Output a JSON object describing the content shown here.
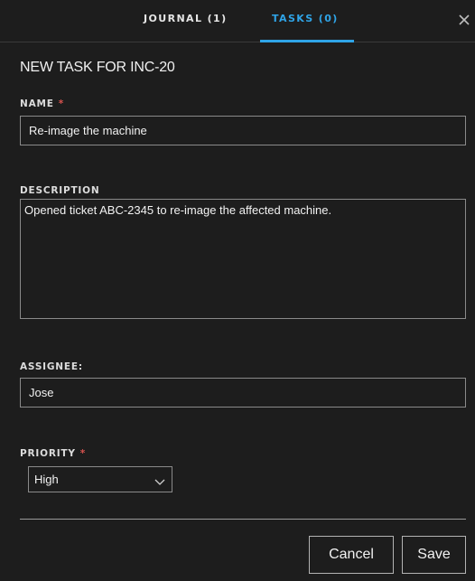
{
  "tabs": {
    "journal": "JOURNAL (1)",
    "tasks": "TASKS (0)"
  },
  "form": {
    "title": "NEW TASK FOR  INC-20",
    "name": {
      "label": "NAME",
      "required_mark": "*",
      "value": "Re-image the machine"
    },
    "description": {
      "label": "DESCRIPTION",
      "value": "Opened ticket ABC-2345 to re-image the affected machine."
    },
    "assignee": {
      "label": "ASSIGNEE:",
      "value": "Jose"
    },
    "priority": {
      "label": "PRIORITY",
      "required_mark": "*",
      "selected": "High"
    }
  },
  "buttons": {
    "cancel": "Cancel",
    "save": "Save"
  },
  "icons": {
    "close": "close-icon",
    "dropdown": "chevron-down-icon"
  },
  "colors": {
    "background": "#1d1d1d",
    "accent": "#2fa4e7",
    "required": "#d9534f",
    "text": "#f2f2f2"
  }
}
